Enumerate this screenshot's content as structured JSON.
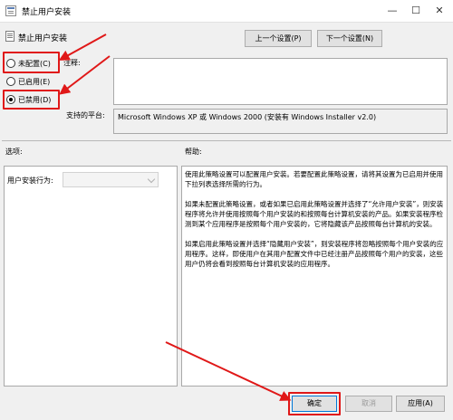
{
  "window": {
    "title": "禁止用户安装",
    "minimize": "—",
    "maximize": "☐",
    "close": "✕"
  },
  "header": {
    "policy_name": "禁止用户安装",
    "prev_button": "上一个设置(P)",
    "next_button": "下一个设置(N)"
  },
  "radios": [
    {
      "label": "未配置(C)",
      "checked": false
    },
    {
      "label": "已启用(E)",
      "checked": false
    },
    {
      "label": "已禁用(D)",
      "checked": true
    }
  ],
  "comment": {
    "label": "注释:",
    "value": ""
  },
  "platform": {
    "label": "支持的平台:",
    "value": "Microsoft Windows XP 或 Windows 2000 (安装有 Windows Installer v2.0)"
  },
  "options": {
    "label": "选项:",
    "behavior_label": "用户安装行为:",
    "behavior_value": ""
  },
  "help": {
    "label": "帮助:",
    "paragraphs": [
      "使用此策略设置可以配置用户安装。若要配置此策略设置，请将其设置为已启用并使用下拉列表选择所需的行为。",
      "如果未配置此策略设置，或者如果已启用此策略设置并选择了“允许用户安装”，则安装程序将允许并使用按照每个用户安装的和按照每台计算机安装的产品。如果安装程序检测到某个应用程序是按照每个用户安装的，它将隐藏该产品按照每台计算机的安装。",
      "如果启用此策略设置并选择“隐藏用户安装”，则安装程序将忽略按照每个用户安装的应用程序。这样，即使用户在其用户配置文件中已经注册产品按照每个用户的安装，这些用户仍将会看到按照每台计算机安装的应用程序。"
    ]
  },
  "footer": {
    "ok": "确定",
    "cancel": "取消",
    "apply": "应用(A)"
  },
  "colors": {
    "highlight_red": "#e01818",
    "dialog_bg": "#f0f0f0",
    "ok_border": "#0078d7"
  },
  "icons": [
    "policy-icon",
    "setting-icon",
    "red-arrow-annotation"
  ]
}
